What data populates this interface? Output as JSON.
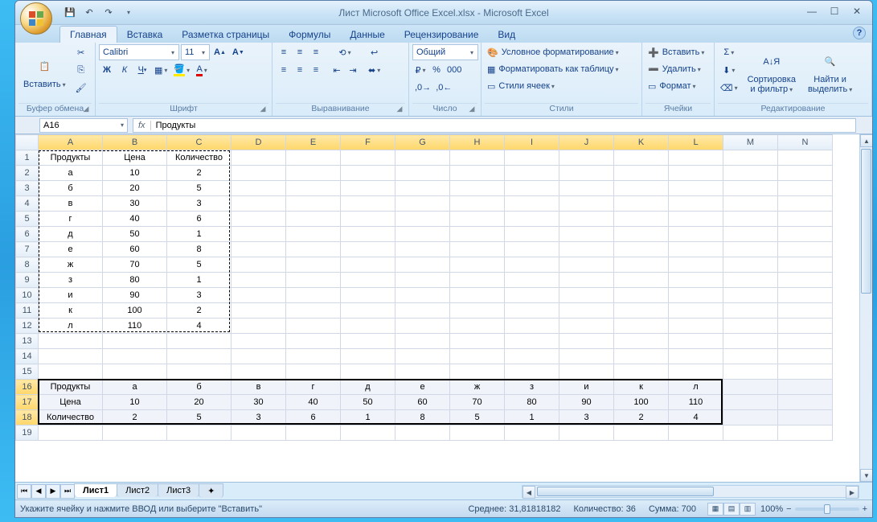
{
  "title": "Лист Microsoft Office Excel.xlsx - Microsoft Excel",
  "tabs": [
    "Главная",
    "Вставка",
    "Разметка страницы",
    "Формулы",
    "Данные",
    "Рецензирование",
    "Вид"
  ],
  "active_tab": 0,
  "groups": {
    "clipboard": {
      "label": "Буфер обмена",
      "paste": "Вставить"
    },
    "font": {
      "label": "Шрифт",
      "name": "Calibri",
      "size": "11"
    },
    "align": {
      "label": "Выравнивание"
    },
    "number": {
      "label": "Число",
      "format": "Общий"
    },
    "styles": {
      "label": "Стили",
      "cond": "Условное форматирование",
      "table": "Форматировать как таблицу",
      "cell": "Стили ячеек"
    },
    "cells": {
      "label": "Ячейки",
      "insert": "Вставить",
      "delete": "Удалить",
      "format": "Формат"
    },
    "editing": {
      "label": "Редактирование",
      "sort": "Сортировка\nи фильтр",
      "find": "Найти и\nвыделить"
    }
  },
  "name_box": "A16",
  "formula": "Продукты",
  "columns": [
    "A",
    "B",
    "C",
    "D",
    "E",
    "F",
    "G",
    "H",
    "I",
    "J",
    "K",
    "L",
    "M",
    "N"
  ],
  "row_count": 19,
  "cells": {
    "A1": "Продукты",
    "B1": "Цена",
    "C1": "Количество",
    "A2": "а",
    "B2": "10",
    "C2": "2",
    "A3": "б",
    "B3": "20",
    "C3": "5",
    "A4": "в",
    "B4": "30",
    "C4": "3",
    "A5": "г",
    "B5": "40",
    "C5": "6",
    "A6": "д",
    "B6": "50",
    "C6": "1",
    "A7": "е",
    "B7": "60",
    "C7": "8",
    "A8": "ж",
    "B8": "70",
    "C8": "5",
    "A9": "з",
    "B9": "80",
    "C9": "1",
    "A10": "и",
    "B10": "90",
    "C10": "3",
    "A11": "к",
    "B11": "100",
    "C11": "2",
    "A12": "л",
    "B12": "110",
    "C12": "4",
    "A16": "Продукты",
    "B16": "а",
    "C16": "б",
    "D16": "в",
    "E16": "г",
    "F16": "д",
    "G16": "е",
    "H16": "ж",
    "I16": "з",
    "J16": "и",
    "K16": "к",
    "L16": "л",
    "A17": "Цена",
    "B17": "10",
    "C17": "20",
    "D17": "30",
    "E17": "40",
    "F17": "50",
    "G17": "60",
    "H17": "70",
    "I17": "80",
    "J17": "90",
    "K17": "100",
    "L17": "110",
    "A18": "Количество",
    "B18": "2",
    "C18": "5",
    "D18": "3",
    "E18": "6",
    "F18": "1",
    "G18": "8",
    "H18": "5",
    "I18": "1",
    "J18": "3",
    "K18": "2",
    "L18": "4"
  },
  "col_widths": {
    "A": 80,
    "B": 80,
    "C": 80
  },
  "sheets": [
    "Лист1",
    "Лист2",
    "Лист3"
  ],
  "status": {
    "msg": "Укажите ячейку и нажмите ВВОД или выберите \"Вставить\"",
    "avg_lbl": "Среднее:",
    "avg": "31,81818182",
    "cnt_lbl": "Количество:",
    "cnt": "36",
    "sum_lbl": "Сумма:",
    "sum": "700",
    "zoom": "100%"
  },
  "marquee": {
    "r1": 1,
    "c1": 1,
    "r2": 12,
    "c2": 3
  },
  "selection": {
    "r1": 16,
    "c1": 1,
    "r2": 18,
    "c2": 12
  }
}
